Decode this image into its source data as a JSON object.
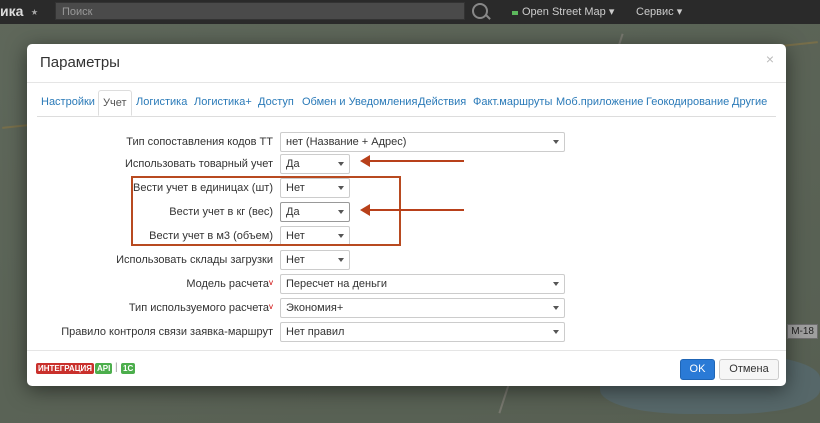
{
  "navbar": {
    "brand": "ика",
    "search_placeholder": "Поиск",
    "map_provider": "Open Street Map",
    "service_menu": "Сервис"
  },
  "map": {
    "road_label": "М-18"
  },
  "modal": {
    "title": "Параметры",
    "close": "×",
    "tabs": [
      {
        "label": "Настройки"
      },
      {
        "label": "Учет"
      },
      {
        "label": "Логистика"
      },
      {
        "label": "Логистика+"
      },
      {
        "label": "Доступ"
      },
      {
        "label": "Обмен и Уведомления"
      },
      {
        "label": "Действия"
      },
      {
        "label": "Факт.маршруты"
      },
      {
        "label": "Моб.приложение"
      },
      {
        "label": "Геокодирование"
      },
      {
        "label": "Другие"
      }
    ],
    "active_tab": "Учет",
    "fields": [
      {
        "label": "Тип сопоставления кодов ТТ",
        "value": "нет (Название + Адрес)",
        "required": false
      },
      {
        "label": "Использовать товарный учет",
        "value": "Да",
        "required": false
      },
      {
        "label": "Вести учет в единицах (шт)",
        "value": "Нет",
        "required": false
      },
      {
        "label": "Вести учет в кг (вес)",
        "value": "Да",
        "required": false
      },
      {
        "label": "Вести учет в м3 (объем)",
        "value": "Нет",
        "required": false
      },
      {
        "label": "Использовать склады загрузки",
        "value": "Нет",
        "required": false
      },
      {
        "label": "Модель расчета",
        "value": "Пересчет на деньги",
        "required": true
      },
      {
        "label": "Тип используемого расчета",
        "value": "Экономия+",
        "required": true
      },
      {
        "label": "Правило контроля связи заявка-маршрут",
        "value": "Нет правил",
        "required": false
      }
    ],
    "required_mark": "v",
    "footer": {
      "badges": [
        "ИНТЕГРАЦИЯ",
        "API",
        "1C"
      ],
      "separator": "|",
      "ok_label": "OK",
      "cancel_label": "Отмена"
    }
  },
  "colors": {
    "accent": "#2a7ad6",
    "annotation": "#b8401a",
    "link": "#2a7ab8"
  }
}
